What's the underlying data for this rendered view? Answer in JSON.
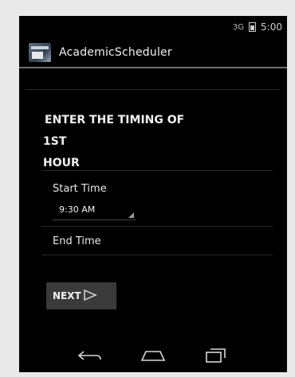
{
  "status_bar": {
    "signal": "3G",
    "time": "5:00"
  },
  "app": {
    "title": "AcademicScheduler"
  },
  "form": {
    "heading_line1": "ENTER THE TIMING OF",
    "heading_line2": "1ST",
    "heading_line3": "HOUR",
    "start_label": "Start Time",
    "start_value": "9:30 AM",
    "end_label": "End Time",
    "next_label": "NEXT"
  },
  "nav": {
    "back": "back-icon",
    "home": "home-icon",
    "recents": "recents-icon"
  }
}
